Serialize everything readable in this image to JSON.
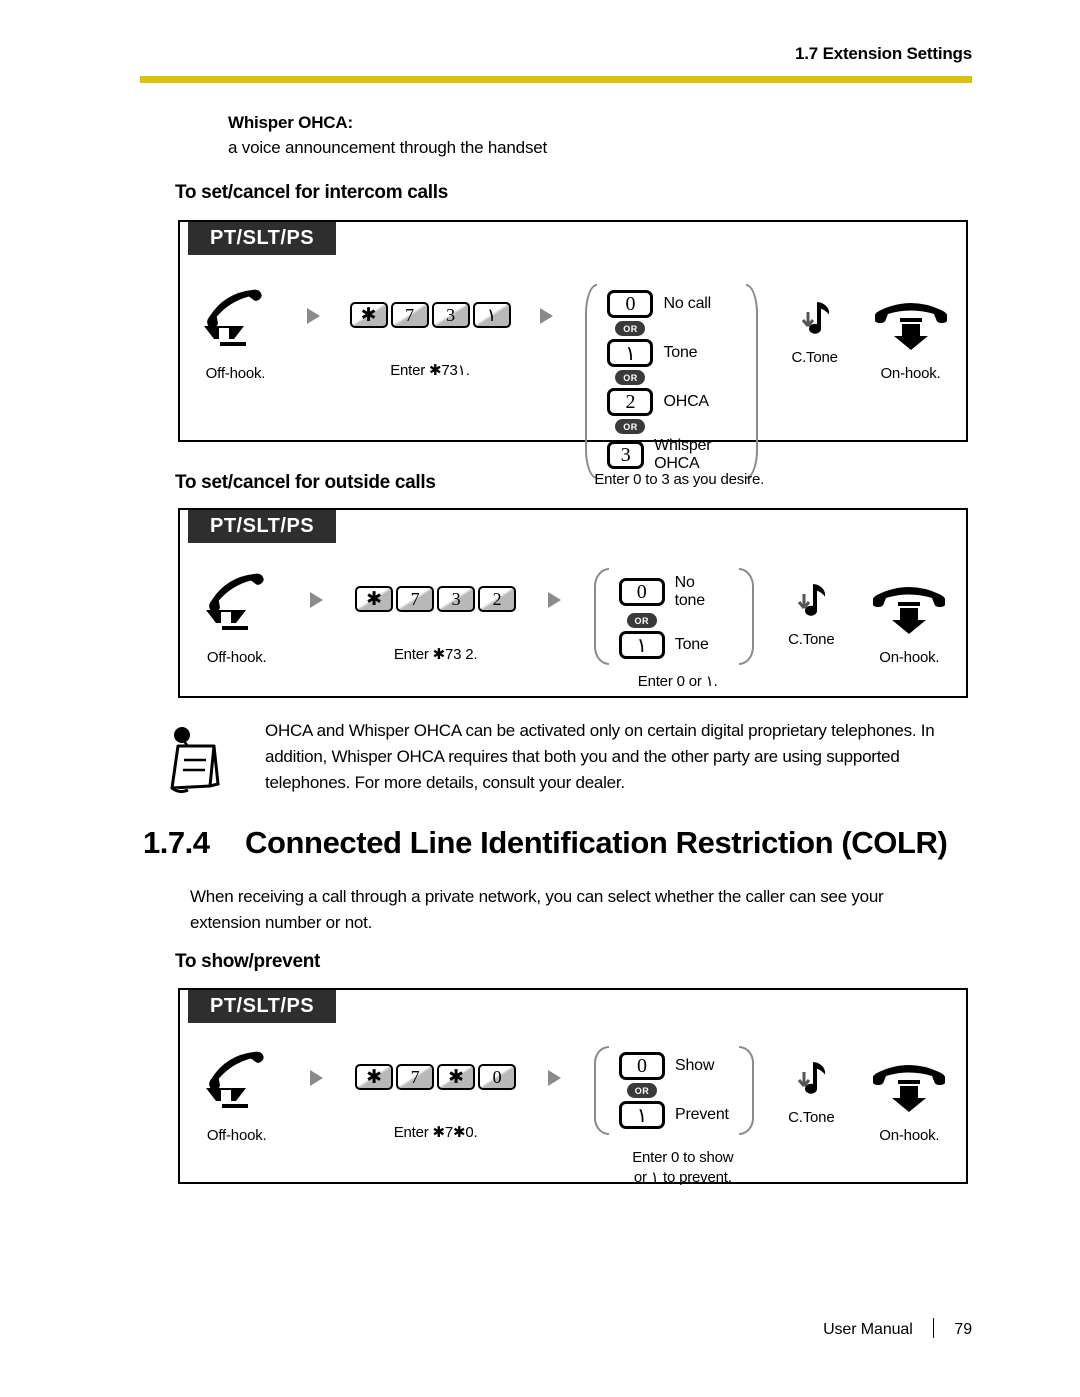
{
  "header": {
    "section_label": "1.7 Extension Settings",
    "rule_color": "#d9c209"
  },
  "lead": {
    "term": "Whisper OHCA:",
    "description": "a voice announcement through the handset"
  },
  "sections": {
    "intercom_heading": "To set/cancel for intercom calls",
    "outside_heading": "To set/cancel for outside calls",
    "show_prevent_heading": "To show/prevent"
  },
  "proc1": {
    "tab": "PT/SLT/PS",
    "offhook_caption": "Off-hook.",
    "enter_caption": "Enter  ✱73١.",
    "keys": [
      "✱",
      "7",
      "3",
      "١"
    ],
    "options": [
      {
        "key": "0",
        "label": "No call"
      },
      {
        "key": "١",
        "label": "Tone"
      },
      {
        "key": "2",
        "label": "OHCA"
      },
      {
        "key": "3",
        "label": "Whisper OHCA"
      }
    ],
    "or_label": "OR",
    "option_note": "Enter 0 to 3 as you desire.",
    "ctone_caption": "C.Tone",
    "onhook_caption": "On-hook."
  },
  "proc2": {
    "tab": "PT/SLT/PS",
    "offhook_caption": "Off-hook.",
    "enter_caption": "Enter  ✱73 2.",
    "keys": [
      "✱",
      "7",
      "3",
      "2"
    ],
    "options": [
      {
        "key": "0",
        "label": "No tone"
      },
      {
        "key": "١",
        "label": "Tone"
      }
    ],
    "or_label": "OR",
    "option_note": "Enter 0 or ١.",
    "ctone_caption": "C.Tone",
    "onhook_caption": "On-hook."
  },
  "proc3": {
    "tab": "PT/SLT/PS",
    "offhook_caption": "Off-hook.",
    "enter_caption": "Enter ✱7✱0.",
    "keys": [
      "✱",
      "7",
      "✱",
      "0"
    ],
    "options": [
      {
        "key": "0",
        "label": "Show"
      },
      {
        "key": "١",
        "label": "Prevent"
      }
    ],
    "or_label": "OR",
    "option_note": "Enter 0 to show\nor ١ to prevent.",
    "ctone_caption": "C.Tone",
    "onhook_caption": "On-hook."
  },
  "note": {
    "text": "OHCA and Whisper OHCA can be activated only on certain digital proprietary telephones. In addition, Whisper OHCA requires that both you and the other party are using supported telephones. For more details, consult your dealer."
  },
  "section_174": {
    "number": "1.7.4",
    "title": "Connected Line Identification Restriction (COLR)",
    "body": "When receiving a call through a private network, you can select whether the caller can see your extension number or not."
  },
  "footer": {
    "manual_label": "User Manual",
    "page_number": "79"
  }
}
